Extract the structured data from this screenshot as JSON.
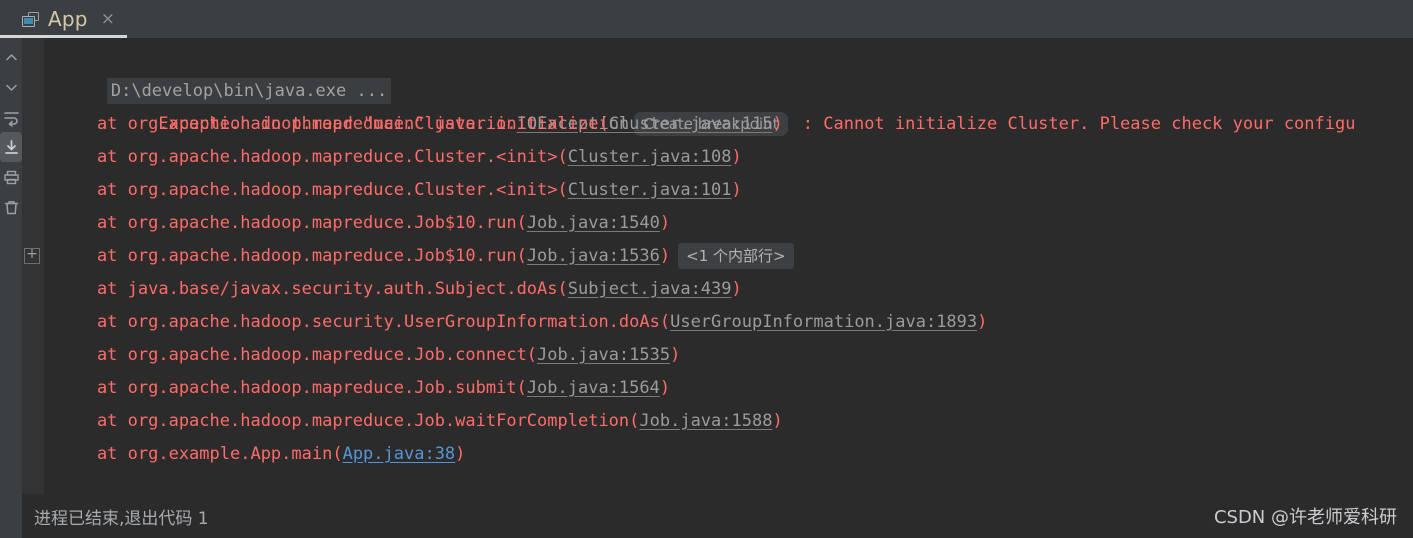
{
  "colors": {
    "window_bg": "#3c3f41",
    "console_bg": "#2b2b2b",
    "gutter_bg": "#313335",
    "error_red": "#ff6b68",
    "link_gray": "#9b9b9b",
    "link_blue": "#5596d8",
    "tab_label": "#d3c9a8",
    "muted_text": "#a7abaf",
    "selected_toolbar": "#55595b"
  },
  "tab": {
    "label": "App",
    "icon": "run-configuration-icon",
    "close_label": "×"
  },
  "toolbar": {
    "items": [
      {
        "name": "up-chevron-icon",
        "tooltip": "Previous Occurrence",
        "selected": false
      },
      {
        "name": "down-chevron-icon",
        "tooltip": "Next Occurrence",
        "selected": false
      },
      {
        "name": "soft-wrap-icon",
        "tooltip": "Soft-Wrap",
        "selected": false
      },
      {
        "name": "scroll-to-end-icon",
        "tooltip": "Scroll to End",
        "selected": true
      },
      {
        "name": "print-icon",
        "tooltip": "Print",
        "selected": false
      },
      {
        "name": "trash-icon",
        "tooltip": "Clear All",
        "selected": false
      }
    ]
  },
  "gutter": {
    "fold_marker": "+"
  },
  "console": {
    "command_line": "D:\\develop\\bin\\java.exe ...",
    "exception": {
      "prefix": "Exception in thread \"main\" java.io.",
      "type": "IOException",
      "breakpoint_badge": "Create breakpoint",
      "separator": " : ",
      "message": "Cannot initialize Cluster. Please check your configu"
    },
    "stack": [
      {
        "text": "    at org.apache.hadoop.mapreduce.Cluster.initialize(",
        "link": "Cluster.java:115",
        "link_style": "gray",
        "suffix": ")",
        "badge": ""
      },
      {
        "text": "    at org.apache.hadoop.mapreduce.Cluster.<init>(",
        "link": "Cluster.java:108",
        "link_style": "gray",
        "suffix": ")",
        "badge": ""
      },
      {
        "text": "    at org.apache.hadoop.mapreduce.Cluster.<init>(",
        "link": "Cluster.java:101",
        "link_style": "gray",
        "suffix": ")",
        "badge": ""
      },
      {
        "text": "    at org.apache.hadoop.mapreduce.Job$10.run(",
        "link": "Job.java:1540",
        "link_style": "gray",
        "suffix": ")",
        "badge": ""
      },
      {
        "text": "    at org.apache.hadoop.mapreduce.Job$10.run(",
        "link": "Job.java:1536",
        "link_style": "gray",
        "suffix": ")",
        "badge": "<1 个内部行>"
      },
      {
        "text": "    at java.base/javax.security.auth.Subject.doAs(",
        "link": "Subject.java:439",
        "link_style": "gray",
        "suffix": ")",
        "badge": ""
      },
      {
        "text": "    at org.apache.hadoop.security.UserGroupInformation.doAs(",
        "link": "UserGroupInformation.java:1893",
        "link_style": "gray",
        "suffix": ")",
        "badge": ""
      },
      {
        "text": "    at org.apache.hadoop.mapreduce.Job.connect(",
        "link": "Job.java:1535",
        "link_style": "gray",
        "suffix": ")",
        "badge": ""
      },
      {
        "text": "    at org.apache.hadoop.mapreduce.Job.submit(",
        "link": "Job.java:1564",
        "link_style": "gray",
        "suffix": ")",
        "badge": ""
      },
      {
        "text": "    at org.apache.hadoop.mapreduce.Job.waitForCompletion(",
        "link": "Job.java:1588",
        "link_style": "gray",
        "suffix": ")",
        "badge": ""
      },
      {
        "text": "    at org.example.App.main(",
        "link": "App.java:38",
        "link_style": "blue",
        "suffix": ")",
        "badge": ""
      }
    ]
  },
  "footer": {
    "exit_message": "进程已结束,退出代码 1",
    "watermark": "CSDN @许老师爱科研"
  }
}
